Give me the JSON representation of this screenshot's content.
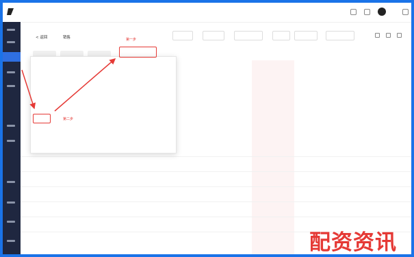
{
  "rail": {
    "items": 11,
    "active_index": 3
  },
  "topbar": {
    "icons": [
      "notification-icon",
      "message-icon",
      "avatar",
      "logout-icon"
    ],
    "user_label": ""
  },
  "toolbar": {
    "breadcrumb": [
      "< 返回",
      "销售"
    ],
    "buttons": [
      "",
      "",
      "",
      "",
      "",
      ""
    ]
  },
  "filters": [
    "",
    "",
    ""
  ],
  "table": {
    "rows": [
      {
        "name": "",
        "gender": "",
        "phone": "",
        "region": "",
        "status": ""
      },
      {
        "name": "",
        "gender": "",
        "phone": "",
        "region": "",
        "status": ""
      },
      {
        "name": "",
        "gender": "",
        "phone": "",
        "region": "",
        "status": ""
      },
      {
        "name": "",
        "gender": "",
        "phone": "",
        "region": "",
        "status": ""
      },
      {
        "name": "",
        "gender": "",
        "phone": "",
        "region": "",
        "status": ""
      },
      {
        "name": "",
        "gender": "",
        "phone": "",
        "region": "",
        "status": ""
      }
    ]
  },
  "dropdown": {
    "col1": [
      "",
      "",
      "",
      "",
      "",
      ""
    ],
    "col2": [
      "",
      "",
      ""
    ],
    "col3": [
      "",
      "",
      ""
    ],
    "highlight_top": "",
    "highlight_left": ""
  },
  "annotations": {
    "step1": "第一步",
    "step2": "第二步"
  },
  "colors": {
    "accent": "#e53935",
    "frame": "#1a73e8",
    "rail": "#1f2740"
  },
  "watermark": "配资资讯"
}
